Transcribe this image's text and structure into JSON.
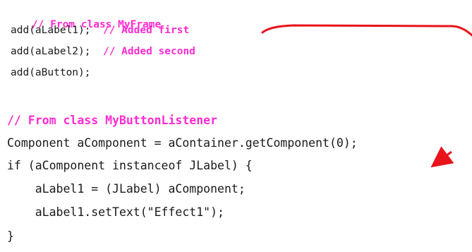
{
  "code": {
    "comment_frame": "// From class MyFrame",
    "add_label1": "add(aLabel1);",
    "comment_added_first": "// Added first",
    "add_label2": "add(aLabel2);",
    "comment_added_second": "// Added second",
    "add_button": "add(aButton);",
    "comment_listener": "// From class MyButtonListener",
    "get_component": "Component aComponent = aContainer.getComponent(0);",
    "if_instanceof": "if (aComponent instanceof JLabel) {",
    "cast_line": "    aLabel1 = (JLabel) aComponent;",
    "set_text": "    aLabel1.setText(\"Effect1\");",
    "close_brace": "}"
  },
  "colors": {
    "comment": "#ff2bd1",
    "code": "#1a1a1a",
    "arrow": "#e8141c"
  }
}
